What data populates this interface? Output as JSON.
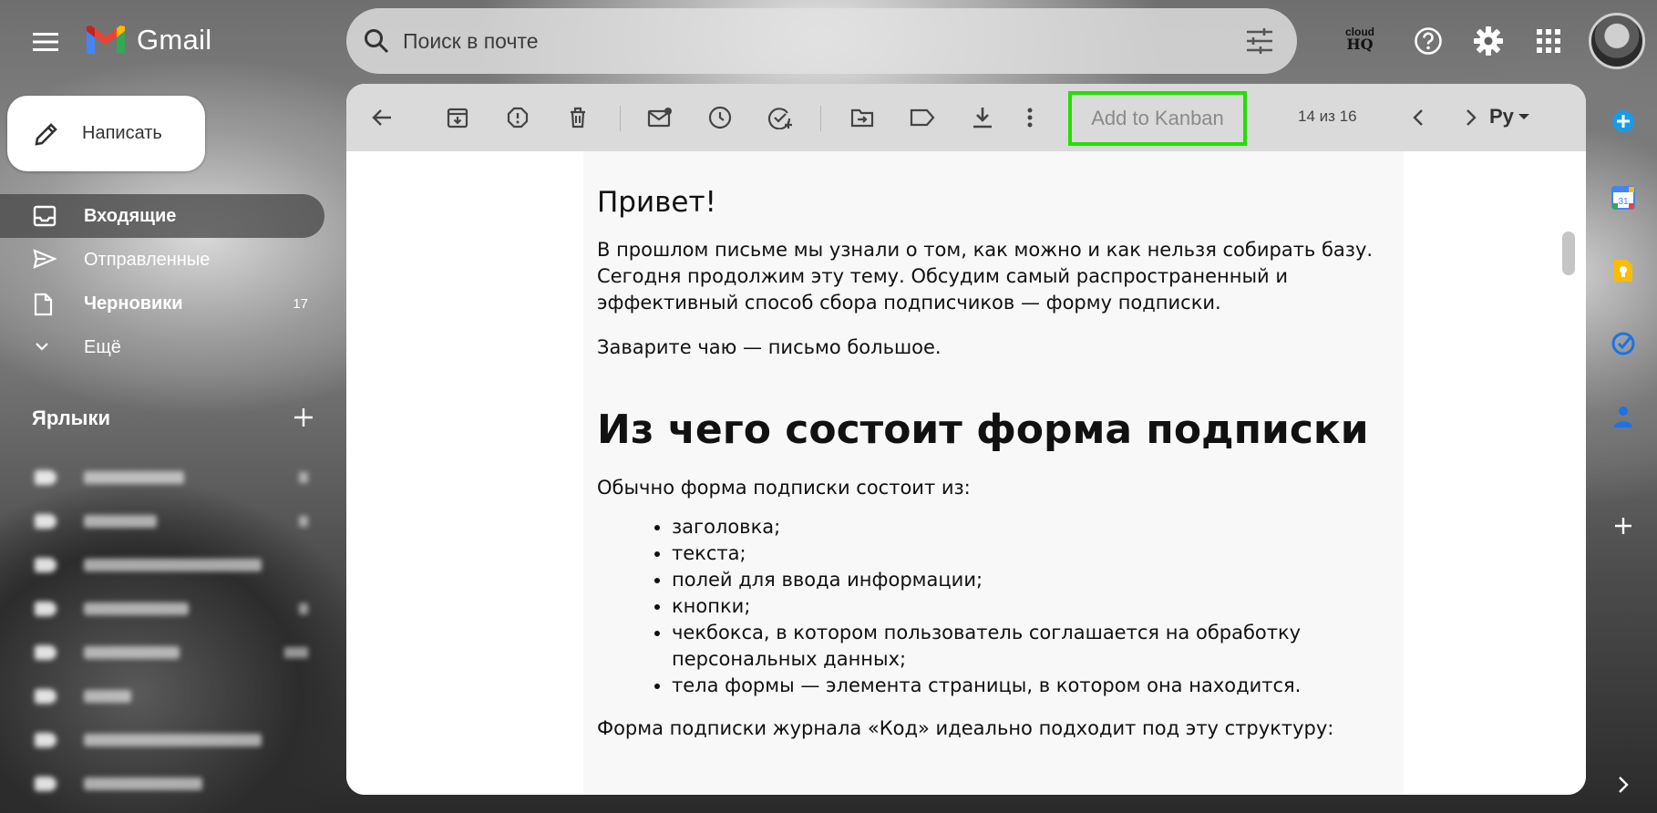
{
  "app": {
    "name": "Gmail"
  },
  "search": {
    "placeholder": "Поиск в почте"
  },
  "header": {
    "cloudhq_line1": "cloud",
    "cloudhq_line2": "HQ"
  },
  "compose": {
    "label": "Написать"
  },
  "sidebar": {
    "items": [
      {
        "label": "Входящие",
        "count": "",
        "icon": "inbox-icon"
      },
      {
        "label": "Отправленные",
        "count": "",
        "icon": "send-icon"
      },
      {
        "label": "Черновики",
        "count": "17",
        "icon": "draft-icon"
      },
      {
        "label": "Ещё",
        "count": "",
        "icon": "chevron-down-icon"
      }
    ],
    "labels_title": "Ярлыки"
  },
  "toolbar": {
    "kanban_label": "Add to Kanban",
    "pager": "14 из 16",
    "lang": "Ру"
  },
  "message": {
    "greeting": "Привет!",
    "intro": "В прошлом письме мы узнали о том, как можно и как нельзя собирать базу. Сегодня продолжим эту тему. Обсудим самый распространенный и эффективный способ сбора подписчиков — форму подписки.",
    "tea": "Заварите чаю — письмо большое.",
    "heading": "Из чего состоит форма подписки",
    "list_intro": "Обычно форма подписки состоит из:",
    "list": [
      "заголовка;",
      "текста;",
      "полей для ввода информации;",
      "кнопки;",
      "чекбокса, в котором пользователь соглашается на обработку персональных данных;",
      "тела формы — элемента страницы, в котором она находится."
    ],
    "outro": "Форма подписки журнала «Код» идеально подходит под эту структуру:"
  },
  "colors": {
    "kanban_border": "#22e000",
    "gmail_red": "#ea4335",
    "gmail_blue": "#4285f4",
    "gmail_green": "#34a853",
    "gmail_yellow": "#fbbc04"
  }
}
